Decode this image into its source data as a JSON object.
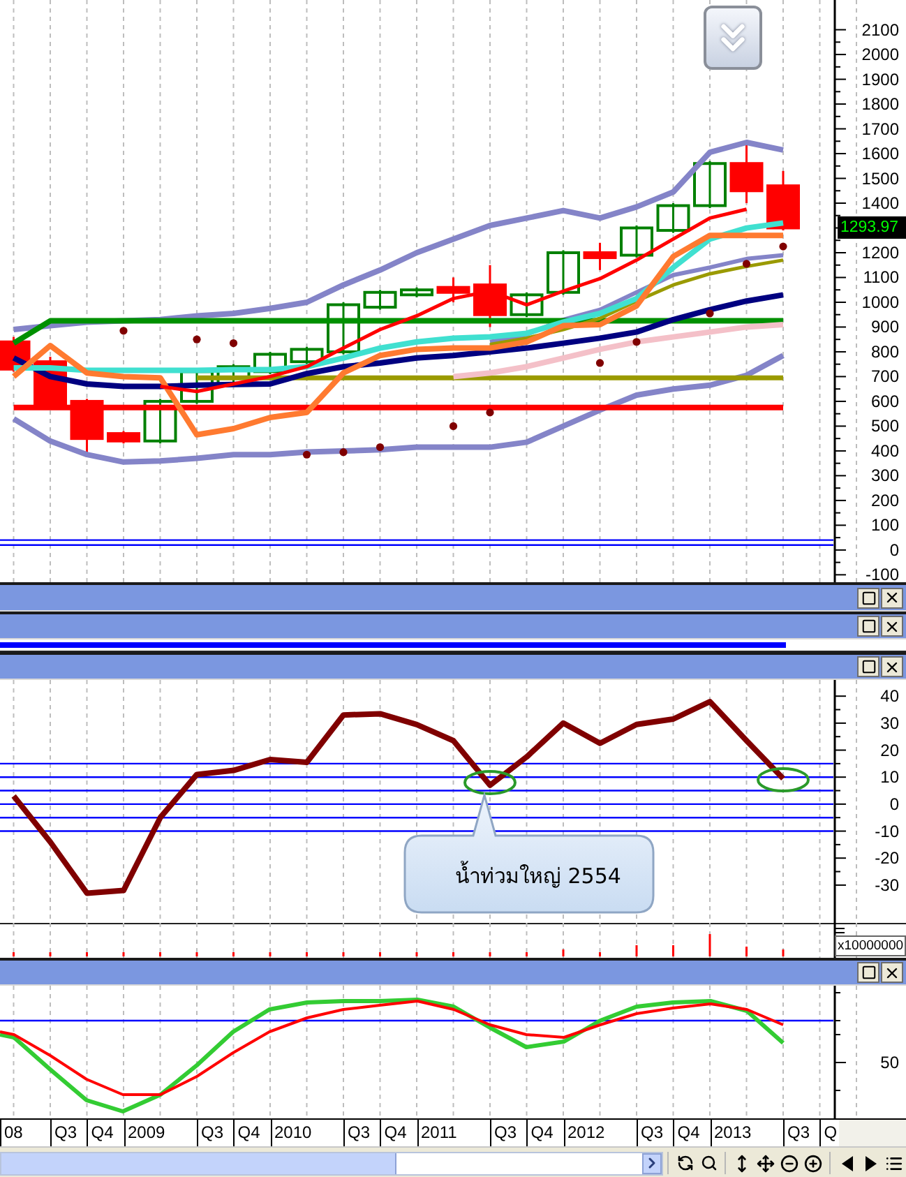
{
  "price_chart": {
    "price_tag": "1293.97",
    "chart_data": {
      "type": "line",
      "grid": true,
      "ylim": [
        -130,
        2220
      ],
      "yticks": [
        -100,
        0,
        100,
        200,
        300,
        400,
        500,
        600,
        700,
        800,
        900,
        1000,
        1100,
        1200,
        1400,
        1500,
        1600,
        1700,
        1800,
        1900,
        2000,
        2100
      ],
      "series": [
        {
          "type": "candlestick",
          "ohlc": [
            [
              840,
              860,
              720,
              730
            ],
            [
              760,
              780,
              570,
              590
            ],
            [
              600,
              610,
              390,
              450
            ],
            [
              470,
              480,
              430,
              440
            ],
            [
              440,
              610,
              430,
              600
            ],
            [
              600,
              730,
              590,
              720
            ],
            [
              670,
              750,
              660,
              740
            ],
            [
              720,
              800,
              710,
              790
            ],
            [
              760,
              820,
              750,
              810
            ],
            [
              800,
              1000,
              790,
              990
            ],
            [
              980,
              1050,
              970,
              1040
            ],
            [
              1030,
              1060,
              1020,
              1050
            ],
            [
              1060,
              1100,
              1000,
              1040
            ],
            [
              1070,
              1150,
              900,
              950
            ],
            [
              950,
              1040,
              940,
              1030
            ],
            [
              1040,
              1210,
              1030,
              1200
            ],
            [
              1200,
              1240,
              1130,
              1180
            ],
            [
              1190,
              1310,
              1180,
              1300
            ],
            [
              1290,
              1400,
              1280,
              1390
            ],
            [
              1390,
              1570,
              1380,
              1560
            ],
            [
              1560,
              1640,
              1400,
              1450
            ],
            [
              1470,
              1530,
              1290,
              1300
            ]
          ]
        },
        {
          "color": "#8484c8",
          "values": [
            890,
            905,
            920,
            925,
            930,
            945,
            955,
            975,
            1000,
            1070,
            1130,
            1200,
            1255,
            1310,
            1340,
            1370,
            1340,
            1385,
            1445,
            1605,
            1645,
            1615
          ]
        },
        {
          "color": "#8484c8",
          "values": [
            530,
            440,
            385,
            355,
            360,
            370,
            385,
            385,
            395,
            400,
            405,
            415,
            415,
            415,
            435,
            500,
            565,
            625,
            650,
            665,
            705,
            785
          ]
        },
        {
          "color": "#8484c8",
          "values": [
            null,
            null,
            null,
            null,
            null,
            null,
            null,
            null,
            null,
            null,
            null,
            null,
            null,
            840,
            870,
            930,
            970,
            1040,
            1110,
            1140,
            1175,
            1190
          ]
        },
        {
          "color": "#009000",
          "values": [
            835,
            925,
            925,
            925,
            925,
            925,
            925,
            925,
            925,
            925,
            925,
            925,
            925,
            925,
            925,
            925,
            925,
            925,
            925,
            925,
            925,
            925
          ]
        },
        {
          "color": "#ff0000",
          "values": [
            575,
            575,
            575,
            575,
            575,
            575,
            575,
            575,
            575,
            575,
            575,
            575,
            575,
            575,
            575,
            575,
            575,
            575,
            575,
            575,
            575,
            575
          ]
        },
        {
          "color": "#9a9a00",
          "values": [
            null,
            null,
            null,
            null,
            null,
            695,
            695,
            695,
            695,
            695,
            695,
            695,
            695,
            695,
            695,
            695,
            695,
            695,
            695,
            695,
            695,
            695
          ]
        },
        {
          "color": "#f4c0c8",
          "values": [
            null,
            null,
            null,
            null,
            null,
            null,
            null,
            null,
            null,
            null,
            null,
            null,
            700,
            715,
            740,
            775,
            810,
            840,
            860,
            880,
            900,
            910
          ]
        },
        {
          "color": "#000080",
          "values": [
            775,
            700,
            670,
            660,
            660,
            665,
            668,
            670,
            712,
            740,
            755,
            775,
            785,
            800,
            815,
            835,
            855,
            880,
            930,
            970,
            1005,
            1030
          ]
        },
        {
          "color": "#9a9a00",
          "values": [
            null,
            null,
            null,
            null,
            null,
            null,
            null,
            null,
            null,
            null,
            null,
            null,
            null,
            830,
            855,
            890,
            935,
            1005,
            1070,
            1115,
            1145,
            1170
          ]
        },
        {
          "color": "#40e0d0",
          "values": [
            735,
            735,
            725,
            725,
            725,
            725,
            728,
            728,
            740,
            775,
            815,
            840,
            855,
            860,
            875,
            920,
            955,
            1015,
            1140,
            1255,
            1300,
            1320
          ]
        },
        {
          "color": "#ff7a30",
          "values": [
            700,
            825,
            715,
            700,
            695,
            465,
            490,
            535,
            555,
            715,
            785,
            810,
            815,
            815,
            840,
            905,
            910,
            985,
            1185,
            1270,
            1270,
            1270
          ]
        },
        {
          "color": "#ff0000",
          "values": [
            null,
            null,
            null,
            null,
            660,
            640,
            670,
            700,
            740,
            815,
            890,
            945,
            1015,
            1045,
            990,
            1045,
            1095,
            1170,
            1255,
            1340,
            1375,
            null
          ]
        },
        {
          "type": "scatter",
          "color": "#800000",
          "values": [
            null,
            null,
            null,
            885,
            null,
            850,
            835,
            null,
            385,
            395,
            415,
            null,
            500,
            555,
            null,
            null,
            755,
            840,
            null,
            955,
            1155,
            1225
          ]
        }
      ],
      "ref_lines": [
        {
          "axis": "y",
          "value": 20,
          "color": "#0000ff"
        },
        {
          "axis": "y",
          "value": 40,
          "color": "#0000ff"
        }
      ]
    }
  },
  "oscillator_chart": {
    "chart_data": {
      "type": "line",
      "grid": true,
      "ylim": [
        -44,
        46
      ],
      "yticks": [
        -30,
        -20,
        -10,
        0,
        10,
        20,
        30,
        40
      ],
      "series": [
        {
          "color": "#800000",
          "values": [
            3,
            -14,
            -33,
            -32,
            -5,
            11,
            12.5,
            16.5,
            15.5,
            33,
            33.5,
            29.5,
            23.5,
            7,
            17.5,
            30,
            22.5,
            29.5,
            31.5,
            38,
            23.5,
            9.5
          ]
        }
      ],
      "ref_lines": [
        {
          "axis": "y",
          "value": 15,
          "color": "#0000ff"
        },
        {
          "axis": "y",
          "value": 10,
          "color": "#0000ff"
        },
        {
          "axis": "y",
          "value": 5,
          "color": "#0000ff"
        },
        {
          "axis": "y",
          "value": 0,
          "color": "#0000ff"
        },
        {
          "axis": "y",
          "value": -5,
          "color": "#0000ff"
        },
        {
          "axis": "y",
          "value": -10,
          "color": "#0000ff"
        }
      ],
      "annotations": [
        "น้ำท่วมใหญ่ 2554"
      ]
    }
  },
  "volume_panel": {
    "scale_label": "x10000000"
  },
  "stochastic_panel": {
    "tick_label": "50"
  },
  "time_axis": {
    "labels": [
      "08",
      "Q3",
      "Q4",
      "2009",
      "Q3",
      "Q4",
      "2010",
      "Q3",
      "Q4",
      "2011",
      "Q3",
      "Q4",
      "2012",
      "Q3",
      "Q4",
      "2013",
      "Q3",
      "Q"
    ]
  }
}
